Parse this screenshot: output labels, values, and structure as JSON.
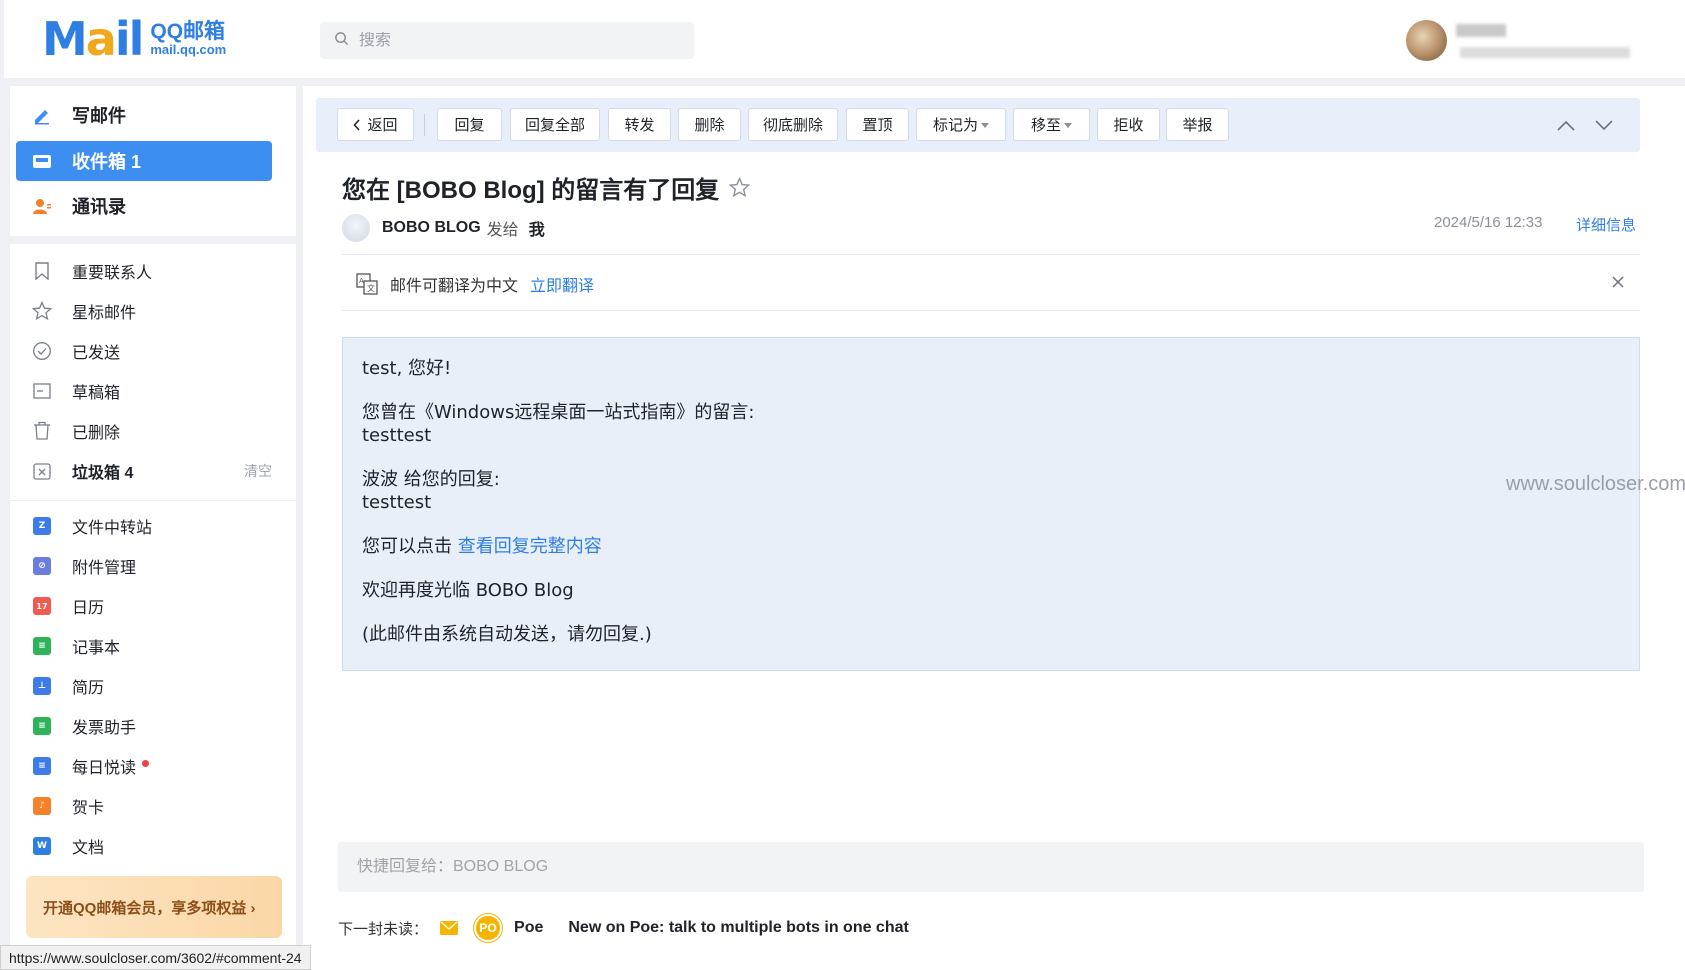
{
  "header": {
    "logo_mail": "Mail",
    "logo_cn": "QQ邮箱",
    "logo_domain": "mail.qq.com",
    "search_placeholder": "搜索"
  },
  "sidebar": {
    "top_items": [
      {
        "label": "写邮件",
        "icon": "compose-icon"
      },
      {
        "label": "收件箱 1",
        "icon": "inbox-icon",
        "active": true
      },
      {
        "label": "通讯录",
        "icon": "contacts-icon"
      }
    ],
    "folders": [
      {
        "label": "重要联系人",
        "icon": "bookmark-icon"
      },
      {
        "label": "星标邮件",
        "icon": "star-icon"
      },
      {
        "label": "已发送",
        "icon": "check-circle-icon"
      },
      {
        "label": "草稿箱",
        "icon": "draft-icon"
      },
      {
        "label": "已删除",
        "icon": "trash-icon"
      },
      {
        "label": "垃圾箱 4",
        "icon": "spam-icon",
        "extra": "清空"
      }
    ],
    "apps": [
      {
        "label": "文件中转站",
        "icon": "file-transfer-icon",
        "glyph": "Z",
        "color": "#3d7be8"
      },
      {
        "label": "附件管理",
        "icon": "attachment-icon",
        "glyph": "⊘",
        "color": "#6b7de0"
      },
      {
        "label": "日历",
        "icon": "calendar-icon",
        "glyph": "17",
        "color": "#f25b4f"
      },
      {
        "label": "记事本",
        "icon": "notepad-icon",
        "glyph": "≡",
        "color": "#2fb35a"
      },
      {
        "label": "简历",
        "icon": "resume-icon",
        "glyph": "⊥",
        "color": "#3d7be8"
      },
      {
        "label": "发票助手",
        "icon": "invoice-icon",
        "glyph": "≡",
        "color": "#2fb35a"
      },
      {
        "label": "每日悦读",
        "icon": "daily-read-icon",
        "glyph": "≡",
        "color": "#3d7be8",
        "dot": true
      },
      {
        "label": "贺卡",
        "icon": "greeting-card-icon",
        "glyph": "♪",
        "color": "#f5822a"
      },
      {
        "label": "文档",
        "icon": "document-icon",
        "glyph": "W",
        "color": "#2f7fe3"
      }
    ],
    "vip_banner": "开通QQ邮箱会员，享多项权益 ›"
  },
  "toolbar": {
    "back": "返回",
    "buttons": [
      {
        "label": "回复",
        "name": "reply-button"
      },
      {
        "label": "回复全部",
        "name": "reply-all-button"
      },
      {
        "label": "转发",
        "name": "forward-button"
      },
      {
        "label": "删除",
        "name": "delete-button"
      },
      {
        "label": "彻底删除",
        "name": "delete-permanently-button"
      },
      {
        "label": "置顶",
        "name": "pin-button"
      },
      {
        "label": "标记为",
        "name": "mark-as-dropdown",
        "dropdown": true
      },
      {
        "label": "移至",
        "name": "move-to-dropdown",
        "dropdown": true
      },
      {
        "label": "拒收",
        "name": "block-button"
      },
      {
        "label": "举报",
        "name": "report-button"
      }
    ]
  },
  "email": {
    "subject": "您在 [BOBO Blog] 的留言有了回复",
    "sender": "BOBO BLOG",
    "sent_to_label": "发给",
    "recipient": "我",
    "date": "2024/5/16 12:33",
    "detail_link": "详细信息",
    "translate_text": "邮件可翻译为中文",
    "translate_link": "立即翻译",
    "body": {
      "greeting": "test, 您好!",
      "comment_intro": "您曾在《Windows远程桌面一站式指南》的留言:",
      "comment_text": "testtest",
      "reply_intro": "波波 给您的回复:",
      "reply_text": "testtest",
      "click_prefix": "您可以点击 ",
      "click_link": "查看回复完整内容",
      "welcome": "欢迎再度光临 BOBO Blog",
      "auto_note": "(此邮件由系统自动发送，请勿回复.)"
    }
  },
  "watermark": "www.soulcloser.com",
  "quick_reply_placeholder": "快捷回复给：BOBO BLOG",
  "next_mail": {
    "label": "下一封未读：",
    "badge": "PO",
    "from": "Poe",
    "subject": "New on Poe: talk to multiple bots in one chat"
  },
  "status_url": "https://www.soulcloser.com/3602/#comment-24",
  "colors": {
    "accent": "#3d8ef1",
    "link": "#2f7fe3",
    "toolbar_bg": "#e8effa",
    "body_bg": "#e9eff8"
  }
}
